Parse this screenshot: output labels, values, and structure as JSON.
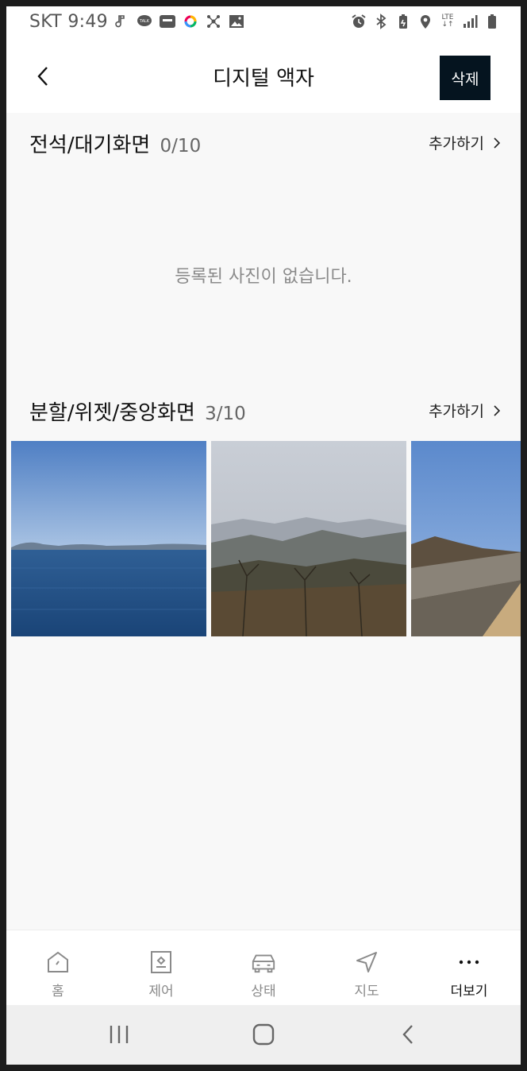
{
  "status_bar": {
    "carrier_time": "SKT 9:49",
    "network": "LTE"
  },
  "header": {
    "title": "디지털 액자",
    "delete_label": "삭제"
  },
  "sections": [
    {
      "title": "전석/대기화면",
      "count": "0/10",
      "add_label": "추가하기",
      "empty_message": "등록된 사진이 없습니다."
    },
    {
      "title": "분할/위젯/중앙화면",
      "count": "3/10",
      "add_label": "추가하기",
      "photos": [
        "ocean-photo",
        "mountain-haze-photo",
        "fortress-wall-photo"
      ]
    }
  ],
  "bottom_nav": {
    "items": [
      {
        "label": "홈",
        "icon": "home-icon"
      },
      {
        "label": "제어",
        "icon": "control-icon"
      },
      {
        "label": "상태",
        "icon": "car-icon"
      },
      {
        "label": "지도",
        "icon": "navigation-icon"
      },
      {
        "label": "더보기",
        "icon": "more-icon",
        "active": true
      }
    ]
  },
  "colors": {
    "accent": "#05141f",
    "background": "#f8f8f8",
    "muted_text": "#8a8a8a"
  }
}
